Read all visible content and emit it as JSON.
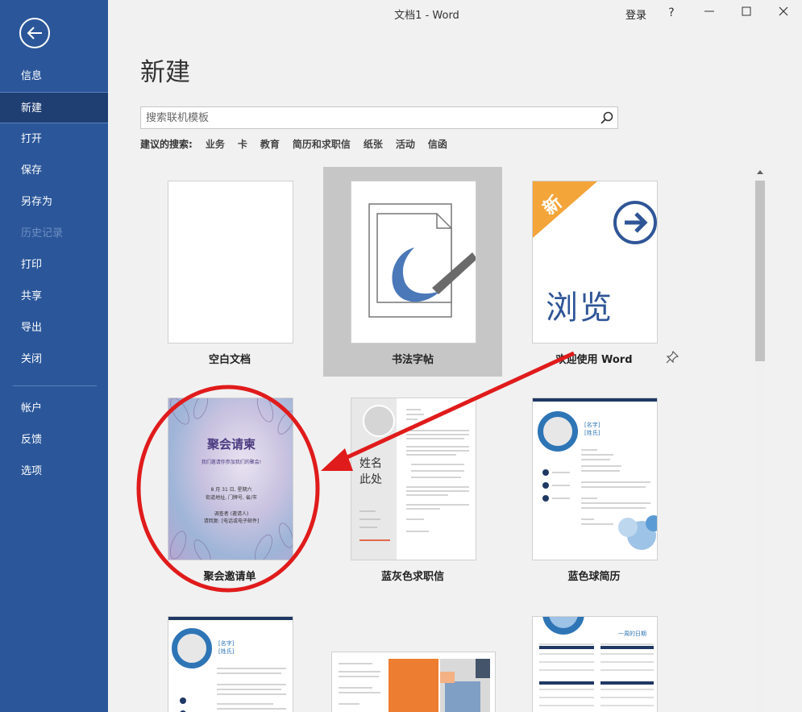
{
  "window": {
    "title": "文档1  -  Word",
    "login": "登录",
    "help": "?",
    "minimize": "—",
    "maximize": "☐",
    "close": "✕"
  },
  "sidebar": {
    "items": [
      {
        "label": "信息"
      },
      {
        "label": "新建",
        "active": true
      },
      {
        "label": "打开"
      },
      {
        "label": "保存"
      },
      {
        "label": "另存为"
      },
      {
        "label": "历史记录",
        "disabled": true
      },
      {
        "label": "打印"
      },
      {
        "label": "共享"
      },
      {
        "label": "导出"
      },
      {
        "label": "关闭"
      },
      {
        "label": "帐户"
      },
      {
        "label": "反馈"
      },
      {
        "label": "选项"
      }
    ]
  },
  "main": {
    "title": "新建",
    "search": {
      "placeholder": "搜索联机模板"
    },
    "suggestions": {
      "label": "建议的搜索:",
      "items": [
        "业务",
        "卡",
        "教育",
        "简历和求职信",
        "纸张",
        "活动",
        "信函"
      ]
    },
    "templates": [
      {
        "label": "空白文档"
      },
      {
        "label": "书法字帖",
        "selected": true
      },
      {
        "label": "欢迎使用 Word",
        "thumb_text": "浏览",
        "badge": "新"
      },
      {
        "label": "聚会邀请单",
        "thumb_title": "聚会请柬",
        "thumb_sub": "我们邀请你参加我们的聚会!",
        "thumb_date": "8 月 31 日, 星期六",
        "thumb_loc": "街道地址, 门牌号, 省/市",
        "thumb_host": "调查者 (邀请人)",
        "thumb_rsvp": "请回复: [电话或电子邮件]"
      },
      {
        "label": "蓝灰色求职信",
        "thumb_name1": "姓名",
        "thumb_name2": "此处"
      },
      {
        "label": "蓝色球简历",
        "thumb_name1": "[名字]",
        "thumb_name2": "[姓氏]"
      },
      {
        "label": "",
        "thumb_name1": "[名字]",
        "thumb_name2": "[姓氏]"
      },
      {
        "label": ""
      },
      {
        "label": "",
        "thumb_title": "一周的日期"
      }
    ]
  }
}
